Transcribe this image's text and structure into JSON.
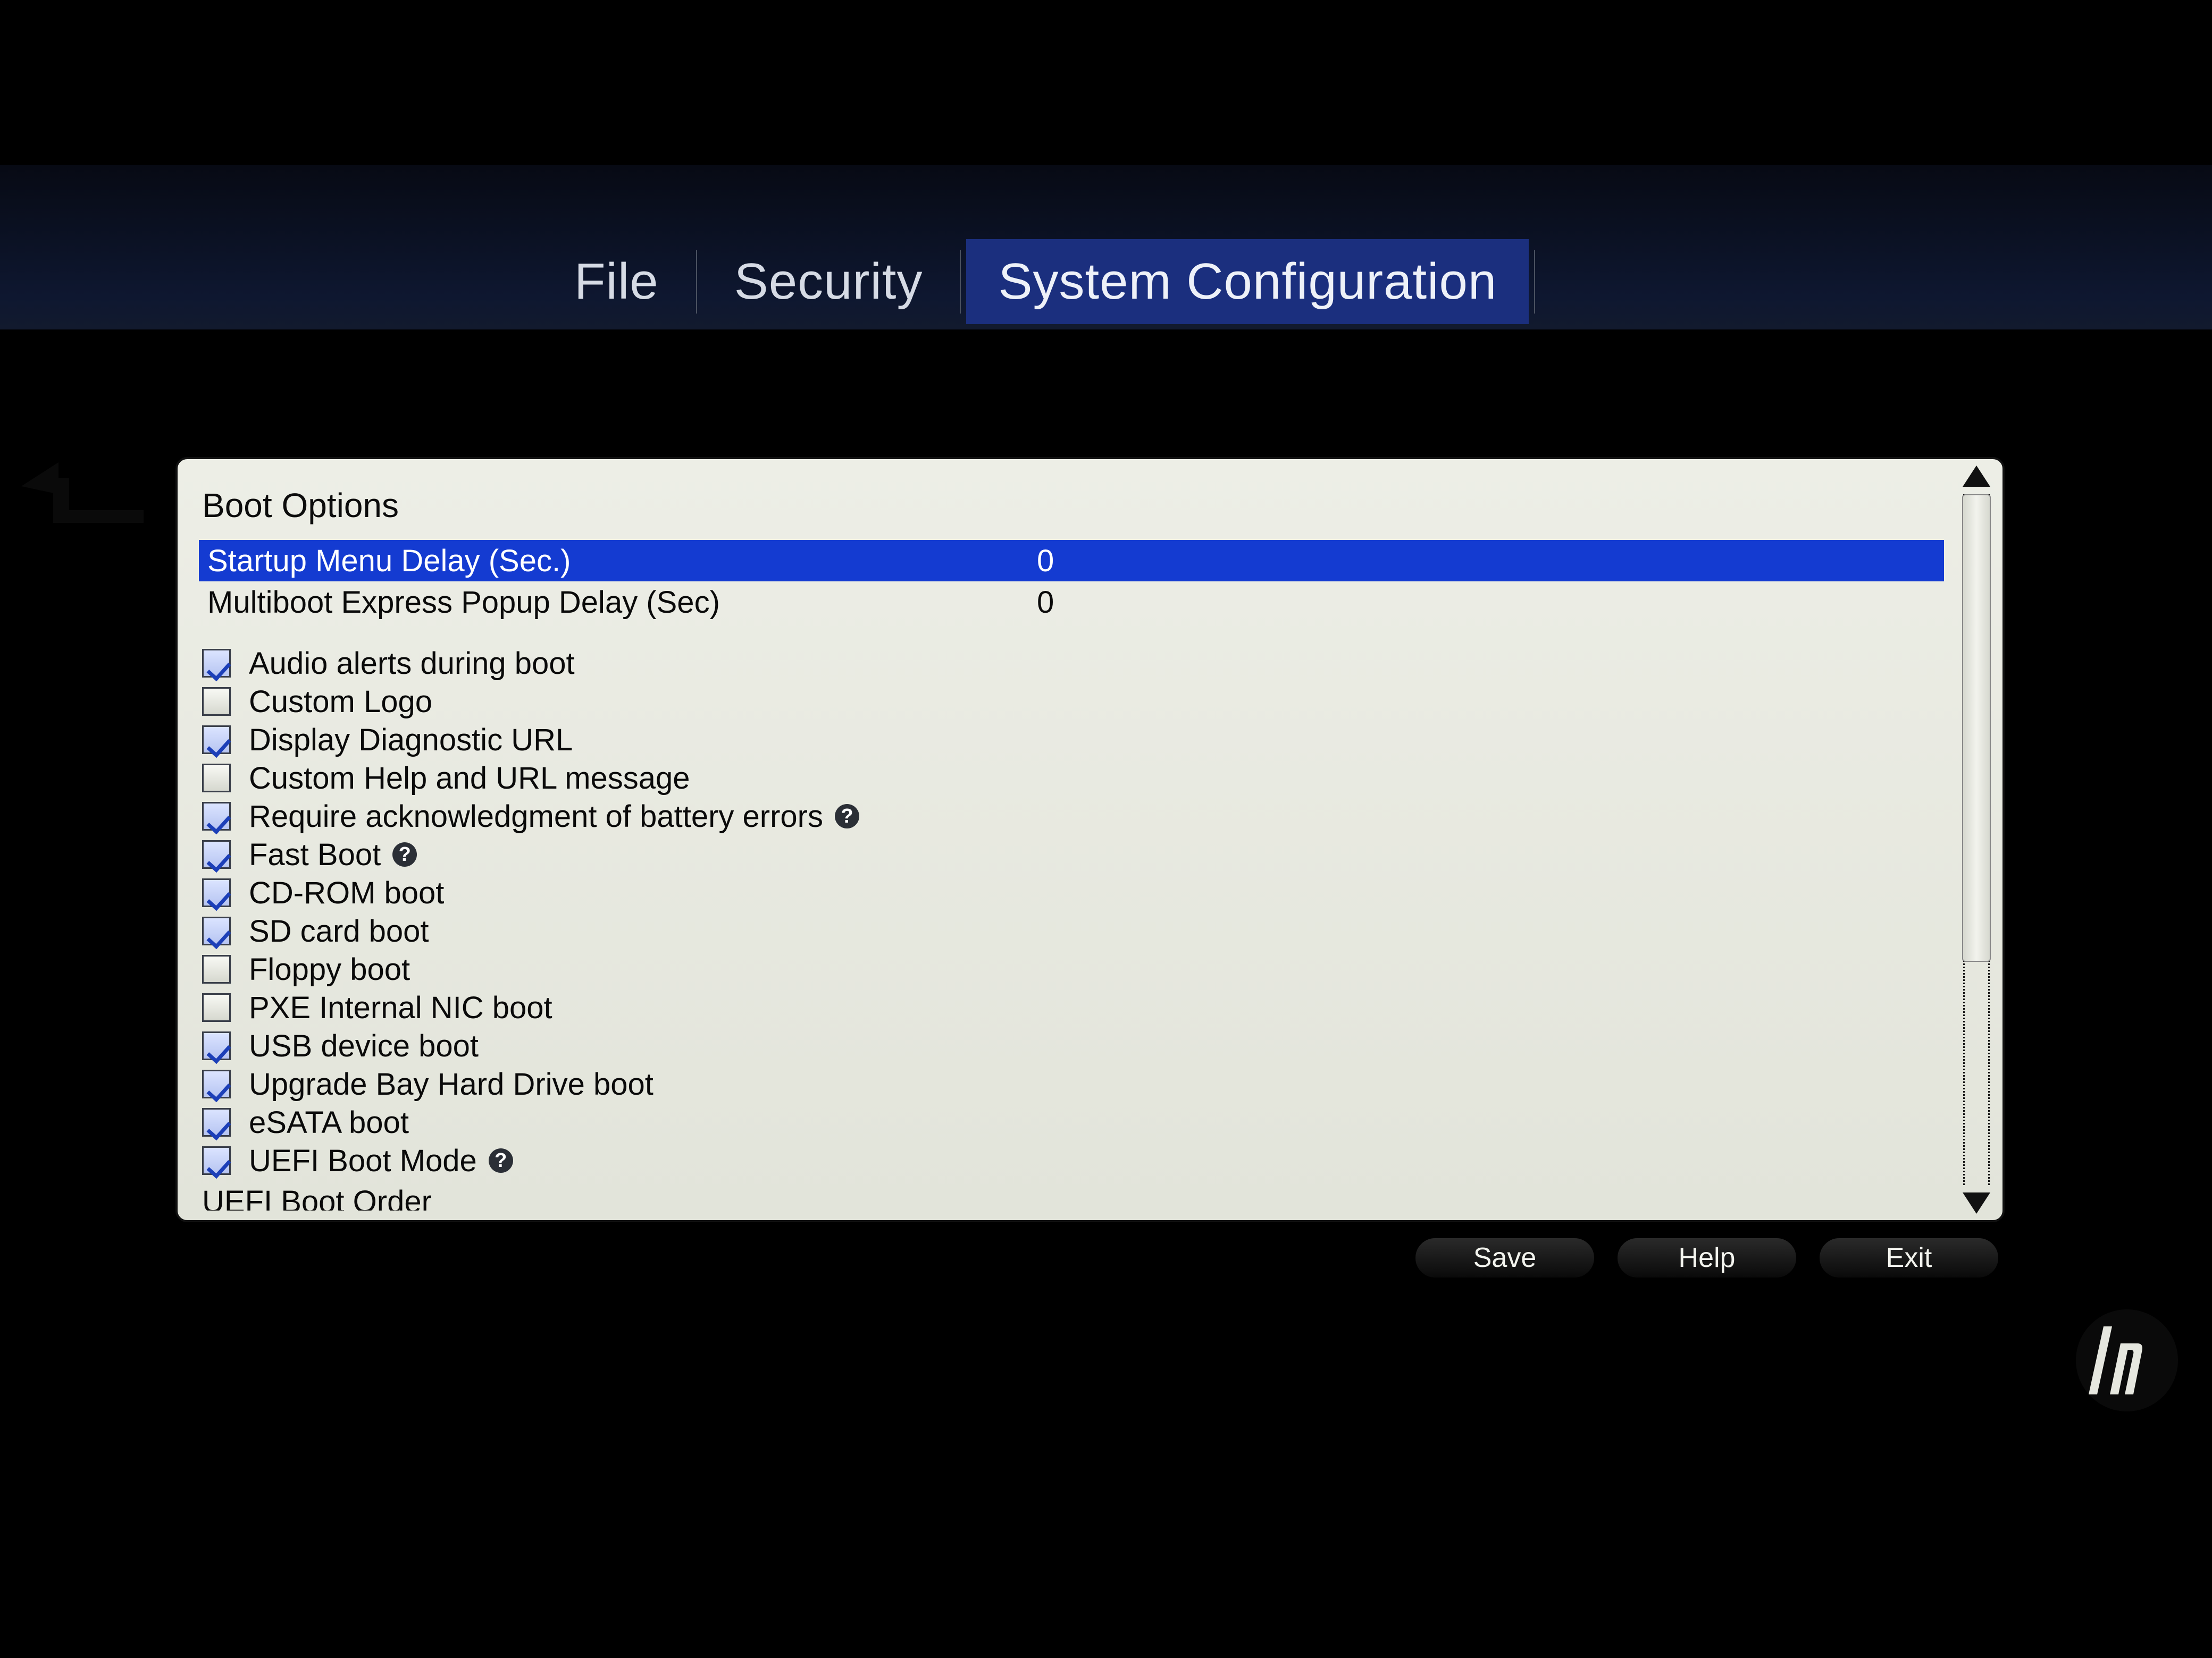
{
  "menubar": {
    "items": [
      {
        "label": "File",
        "active": false
      },
      {
        "label": "Security",
        "active": false
      },
      {
        "label": "System Configuration",
        "active": true
      }
    ]
  },
  "panel": {
    "title": "Boot Options",
    "value_rows": [
      {
        "label": "Startup Menu Delay (Sec.)",
        "value": "0",
        "selected": true
      },
      {
        "label": "Multiboot Express Popup Delay (Sec)",
        "value": "0",
        "selected": false
      }
    ],
    "check_rows": [
      {
        "label": "Audio alerts during boot",
        "checked": true,
        "help": false
      },
      {
        "label": "Custom Logo",
        "checked": false,
        "help": false
      },
      {
        "label": "Display Diagnostic URL",
        "checked": true,
        "help": false
      },
      {
        "label": "Custom Help and URL message",
        "checked": false,
        "help": false
      },
      {
        "label": "Require acknowledgment of battery errors",
        "checked": true,
        "help": true
      },
      {
        "label": "Fast Boot",
        "checked": true,
        "help": true
      },
      {
        "label": "CD-ROM boot",
        "checked": true,
        "help": false
      },
      {
        "label": "SD card boot",
        "checked": true,
        "help": false
      },
      {
        "label": "Floppy boot",
        "checked": false,
        "help": false
      },
      {
        "label": "PXE Internal NIC boot",
        "checked": false,
        "help": false
      },
      {
        "label": "USB device boot",
        "checked": true,
        "help": false
      },
      {
        "label": "Upgrade Bay Hard Drive boot",
        "checked": true,
        "help": false
      },
      {
        "label": "eSATA boot",
        "checked": true,
        "help": false
      },
      {
        "label": "UEFI Boot Mode",
        "checked": true,
        "help": true
      }
    ],
    "cutoff_label": "UEFI Boot Order"
  },
  "buttons": {
    "save": "Save",
    "help": "Help",
    "exit": "Exit"
  },
  "brand": "hp"
}
